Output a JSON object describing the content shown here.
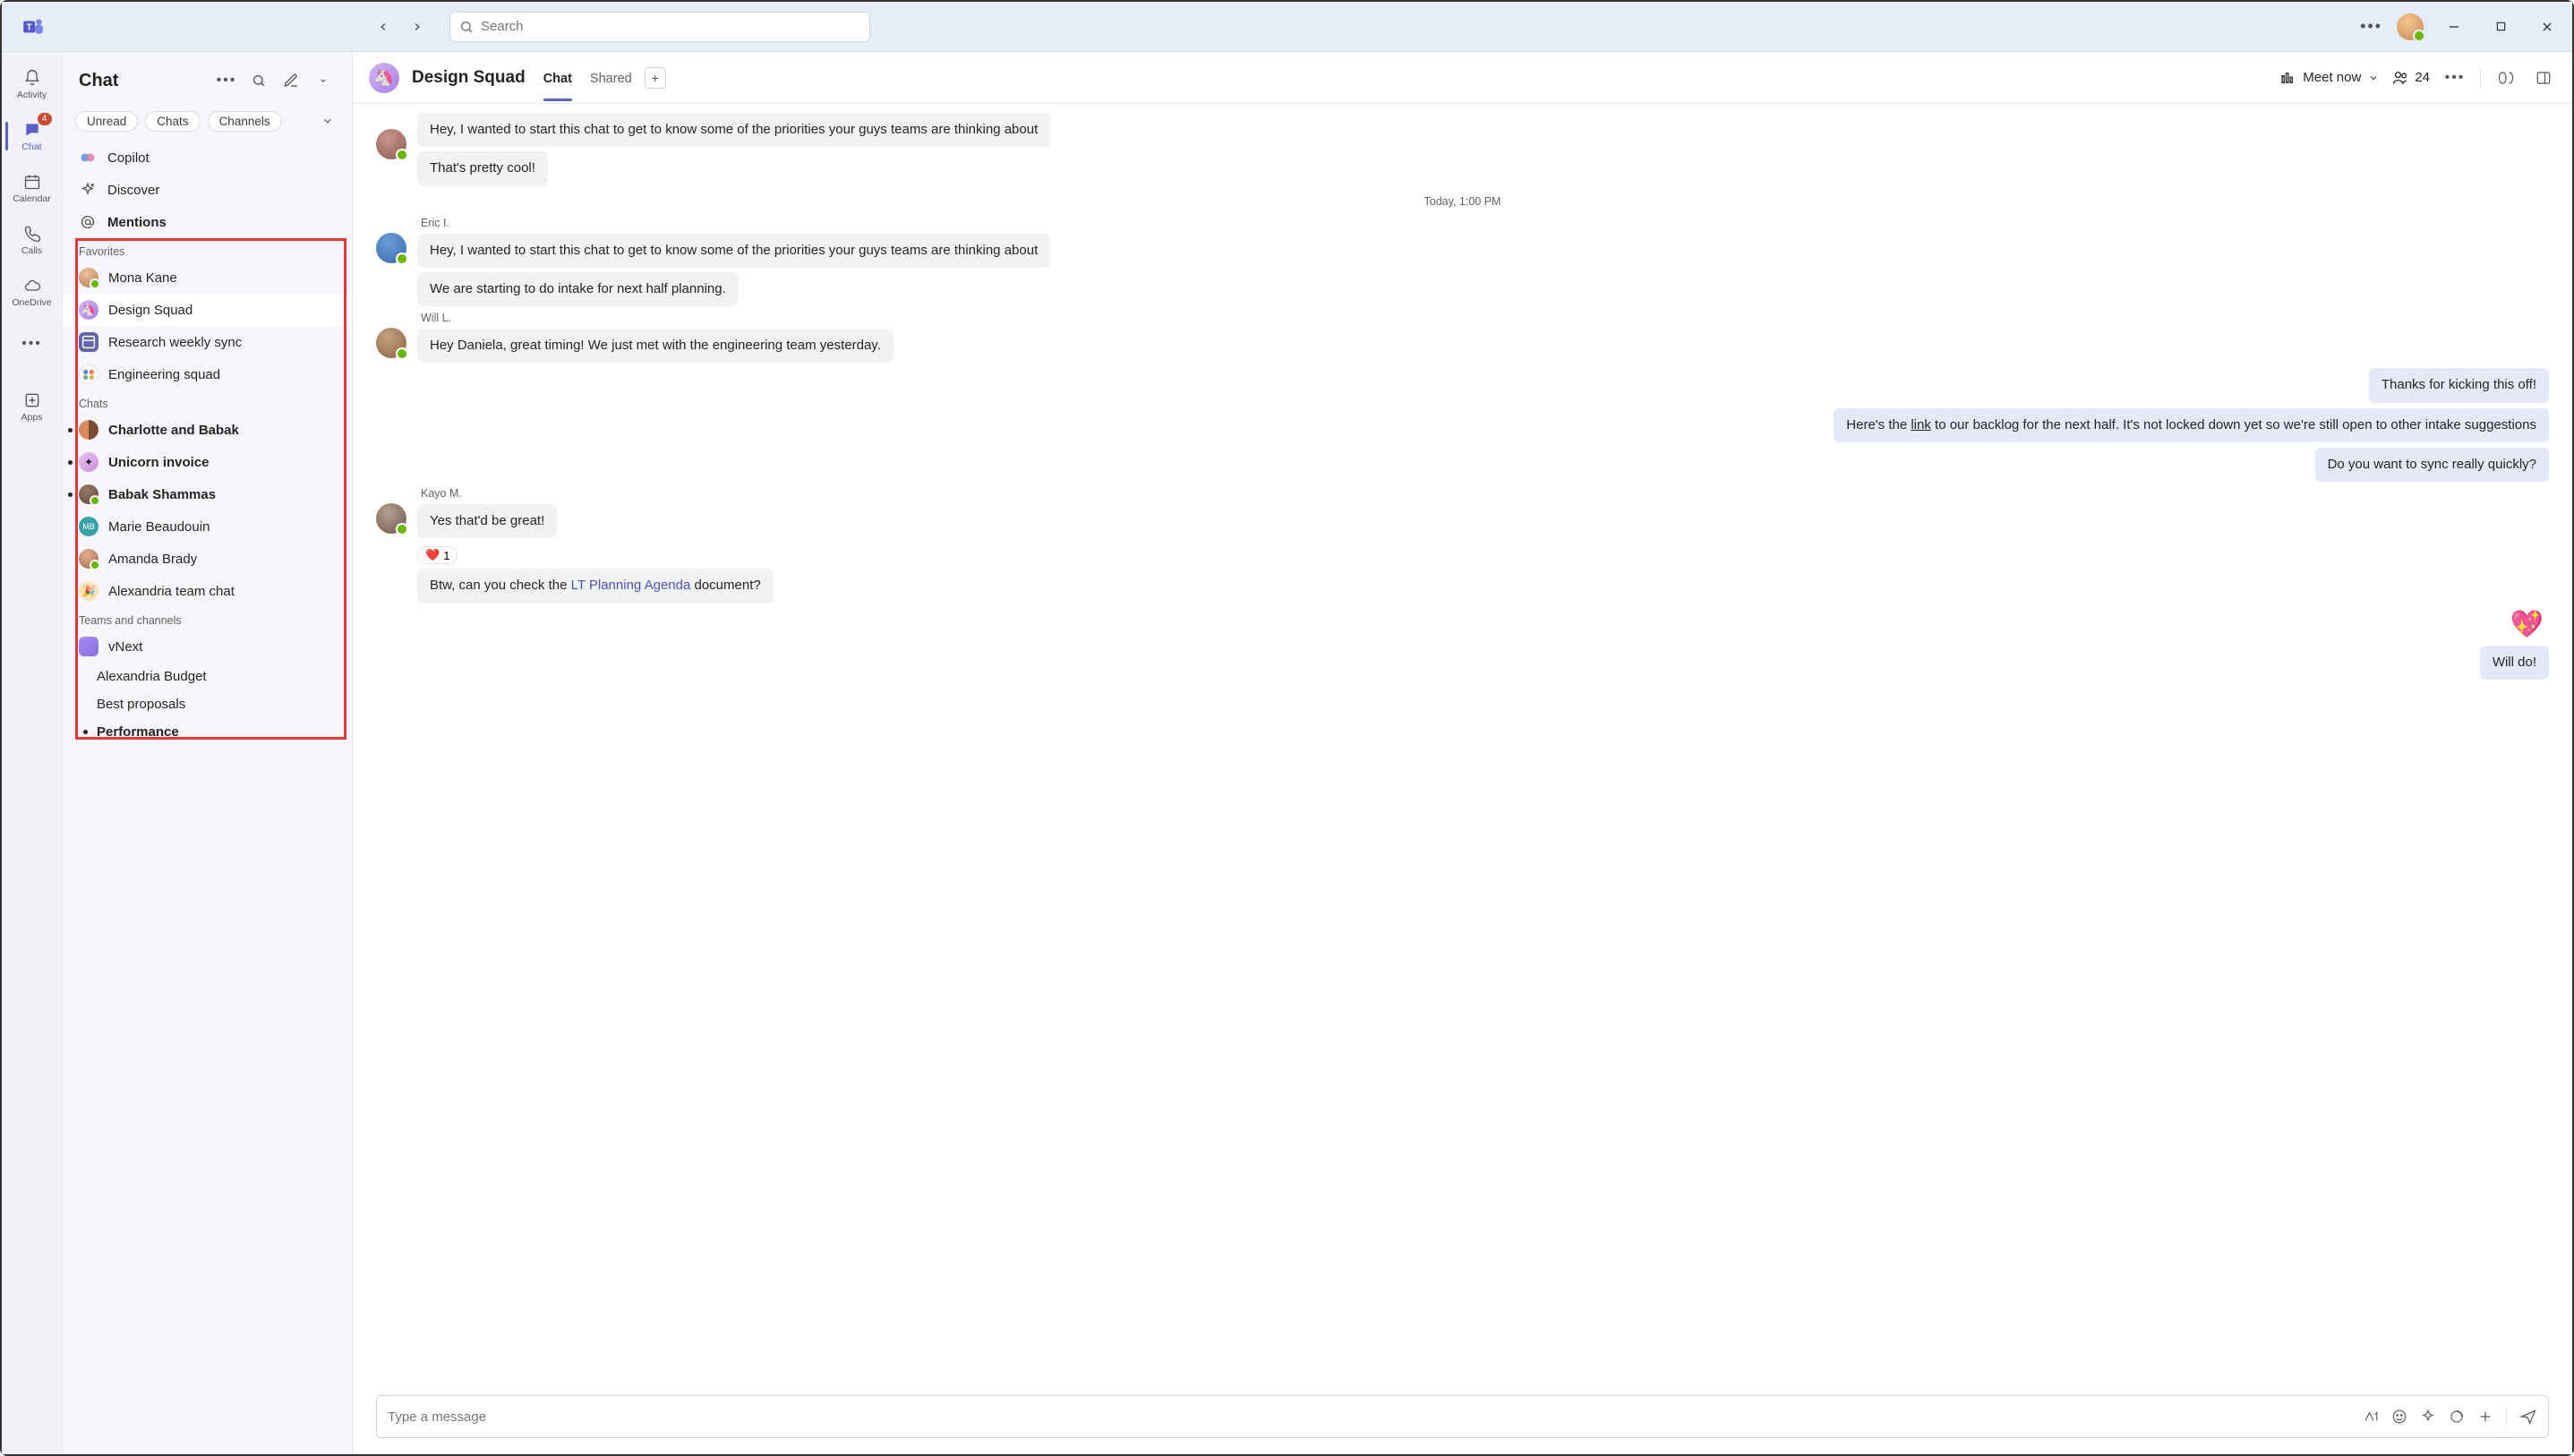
{
  "search": {
    "placeholder": "Search"
  },
  "rail": {
    "activity": "Activity",
    "chat": "Chat",
    "chat_badge": "4",
    "calendar": "Calendar",
    "calls": "Calls",
    "onedrive": "OneDrive",
    "apps": "Apps"
  },
  "sidebar": {
    "title": "Chat",
    "pills": {
      "unread": "Unread",
      "chats": "Chats",
      "channels": "Channels"
    },
    "nav": {
      "copilot": "Copilot",
      "discover": "Discover",
      "mentions": "Mentions"
    },
    "sections": {
      "favorites": "Favorites",
      "chats": "Chats",
      "teams": "Teams and channels"
    },
    "favorites": [
      {
        "label": "Mona Kane"
      },
      {
        "label": "Design Squad"
      },
      {
        "label": "Research weekly sync"
      },
      {
        "label": "Engineering squad"
      }
    ],
    "chats": [
      {
        "label": "Charlotte and Babak"
      },
      {
        "label": "Unicorn invoice"
      },
      {
        "label": "Babak Shammas"
      },
      {
        "label": "Marie Beaudouin",
        "initials": "MB"
      },
      {
        "label": "Amanda Brady"
      },
      {
        "label": "Alexandria team chat"
      }
    ],
    "teams": {
      "name": "vNext",
      "channels": [
        {
          "label": "Alexandria Budget"
        },
        {
          "label": "Best proposals"
        },
        {
          "label": "Performance"
        }
      ]
    }
  },
  "header": {
    "title": "Design Squad",
    "tabs": {
      "chat": "Chat",
      "shared": "Shared"
    },
    "meet": "Meet now",
    "people_count": "24"
  },
  "messages": {
    "top1": "Hey, I wanted to start this chat to get to know some of the priorities your guys teams are thinking about",
    "top2": "That's pretty cool!",
    "time_sep": "Today, 1:00 PM",
    "eric_name": "Eric I.",
    "eric1": "Hey, I wanted to start this chat to get to know some of the priorities your guys teams are thinking about",
    "eric2": "We are starting to do intake for next half planning.",
    "will_name": "Will L.",
    "will1": "Hey Daniela, great timing! We just met with the engineering team yesterday.",
    "mine1": "Thanks for kicking this off!",
    "mine2_pre": "Here's the ",
    "mine2_link": "link",
    "mine2_post": " to our backlog for the next half. It's not locked down yet so we're still open to other intake suggestions",
    "mine3": "Do you want to sync really quickly?",
    "kayo_name": "Kayo M.",
    "kayo1": "Yes that'd be great!",
    "kayo_react": "1",
    "kayo2_pre": "Btw, can you check the ",
    "kayo2_link": "LT Planning Agenda",
    "kayo2_post": " document?",
    "mine4": "Will do!"
  },
  "composer": {
    "placeholder": "Type a message"
  }
}
